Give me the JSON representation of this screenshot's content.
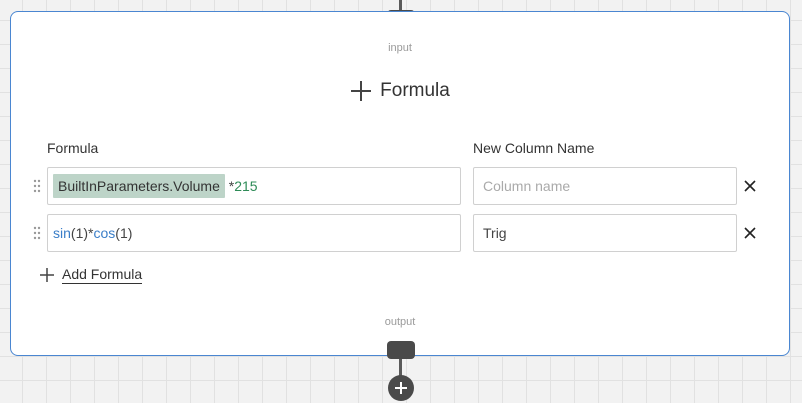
{
  "node": {
    "input_label": "input",
    "output_label": "output",
    "title": "Formula",
    "headers": {
      "formula": "Formula",
      "new_column": "New Column Name"
    },
    "rows": [
      {
        "chip": "BuiltInParameters.Volume",
        "rest_op": " *",
        "rest_num": "215",
        "column_value": "",
        "column_placeholder": "Column name"
      },
      {
        "fn1": "sin",
        "arg1": "(1)",
        "op": "*",
        "fn2": "cos",
        "arg2": "(1)",
        "column_value": "Trig",
        "column_placeholder": "Column name"
      }
    ],
    "add_formula_label": "Add Formula"
  },
  "colors": {
    "accent_border": "#4a86d1",
    "chip_bg": "#bdd4c8",
    "function": "#3a7ec8",
    "number": "#2e8b57"
  }
}
